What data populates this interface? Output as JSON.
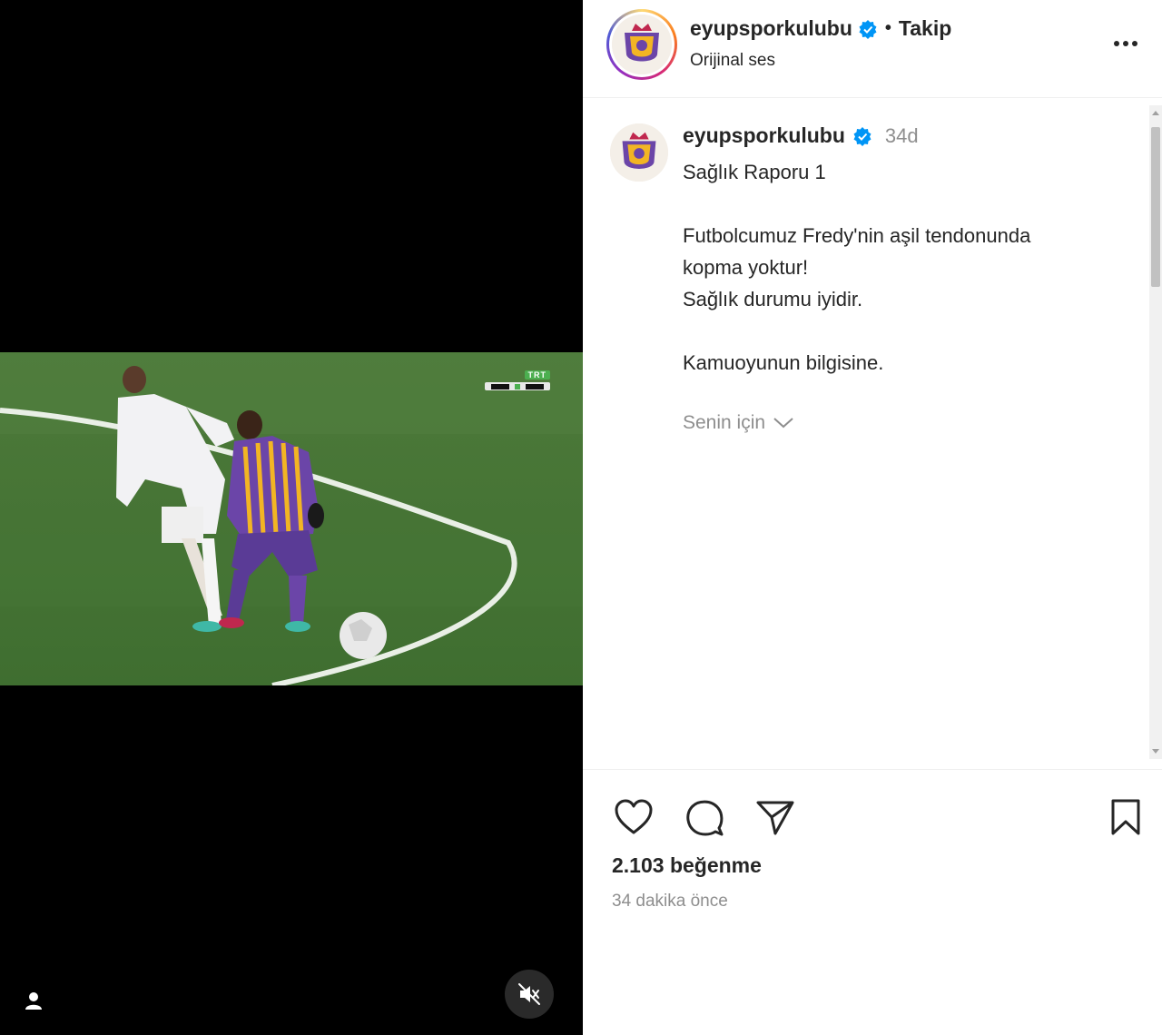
{
  "video": {
    "broadcaster": "TRT",
    "scoreboard": "",
    "accent_color": "#4caf50"
  },
  "header": {
    "username": "eyupsporkulubu",
    "separator": "•",
    "follow_label": "Takip",
    "audio_label": "Orijinal ses"
  },
  "caption": {
    "username": "eyupsporkulubu",
    "time": "34d",
    "text": "Sağlık Raporu 1\n\nFutbolcumuz Fredy'nin aşil tendonunda\nkopma yoktur!\nSağlık durumu iyidir.\n\nKamuoyunun bilgisine.",
    "translate_label": "Senin için"
  },
  "stats": {
    "likes": "2.103 beğenme",
    "posted": "34 dakika önce"
  },
  "colors": {
    "verified": "#0095f6",
    "muted_text": "#8e8e8e",
    "primary_text": "#262626"
  },
  "icons": [
    "verified-badge-icon",
    "more-options-icon",
    "heart-icon",
    "comment-icon",
    "share-icon",
    "bookmark-icon",
    "mute-icon",
    "user-tag-icon",
    "chevron-down-icon"
  ]
}
